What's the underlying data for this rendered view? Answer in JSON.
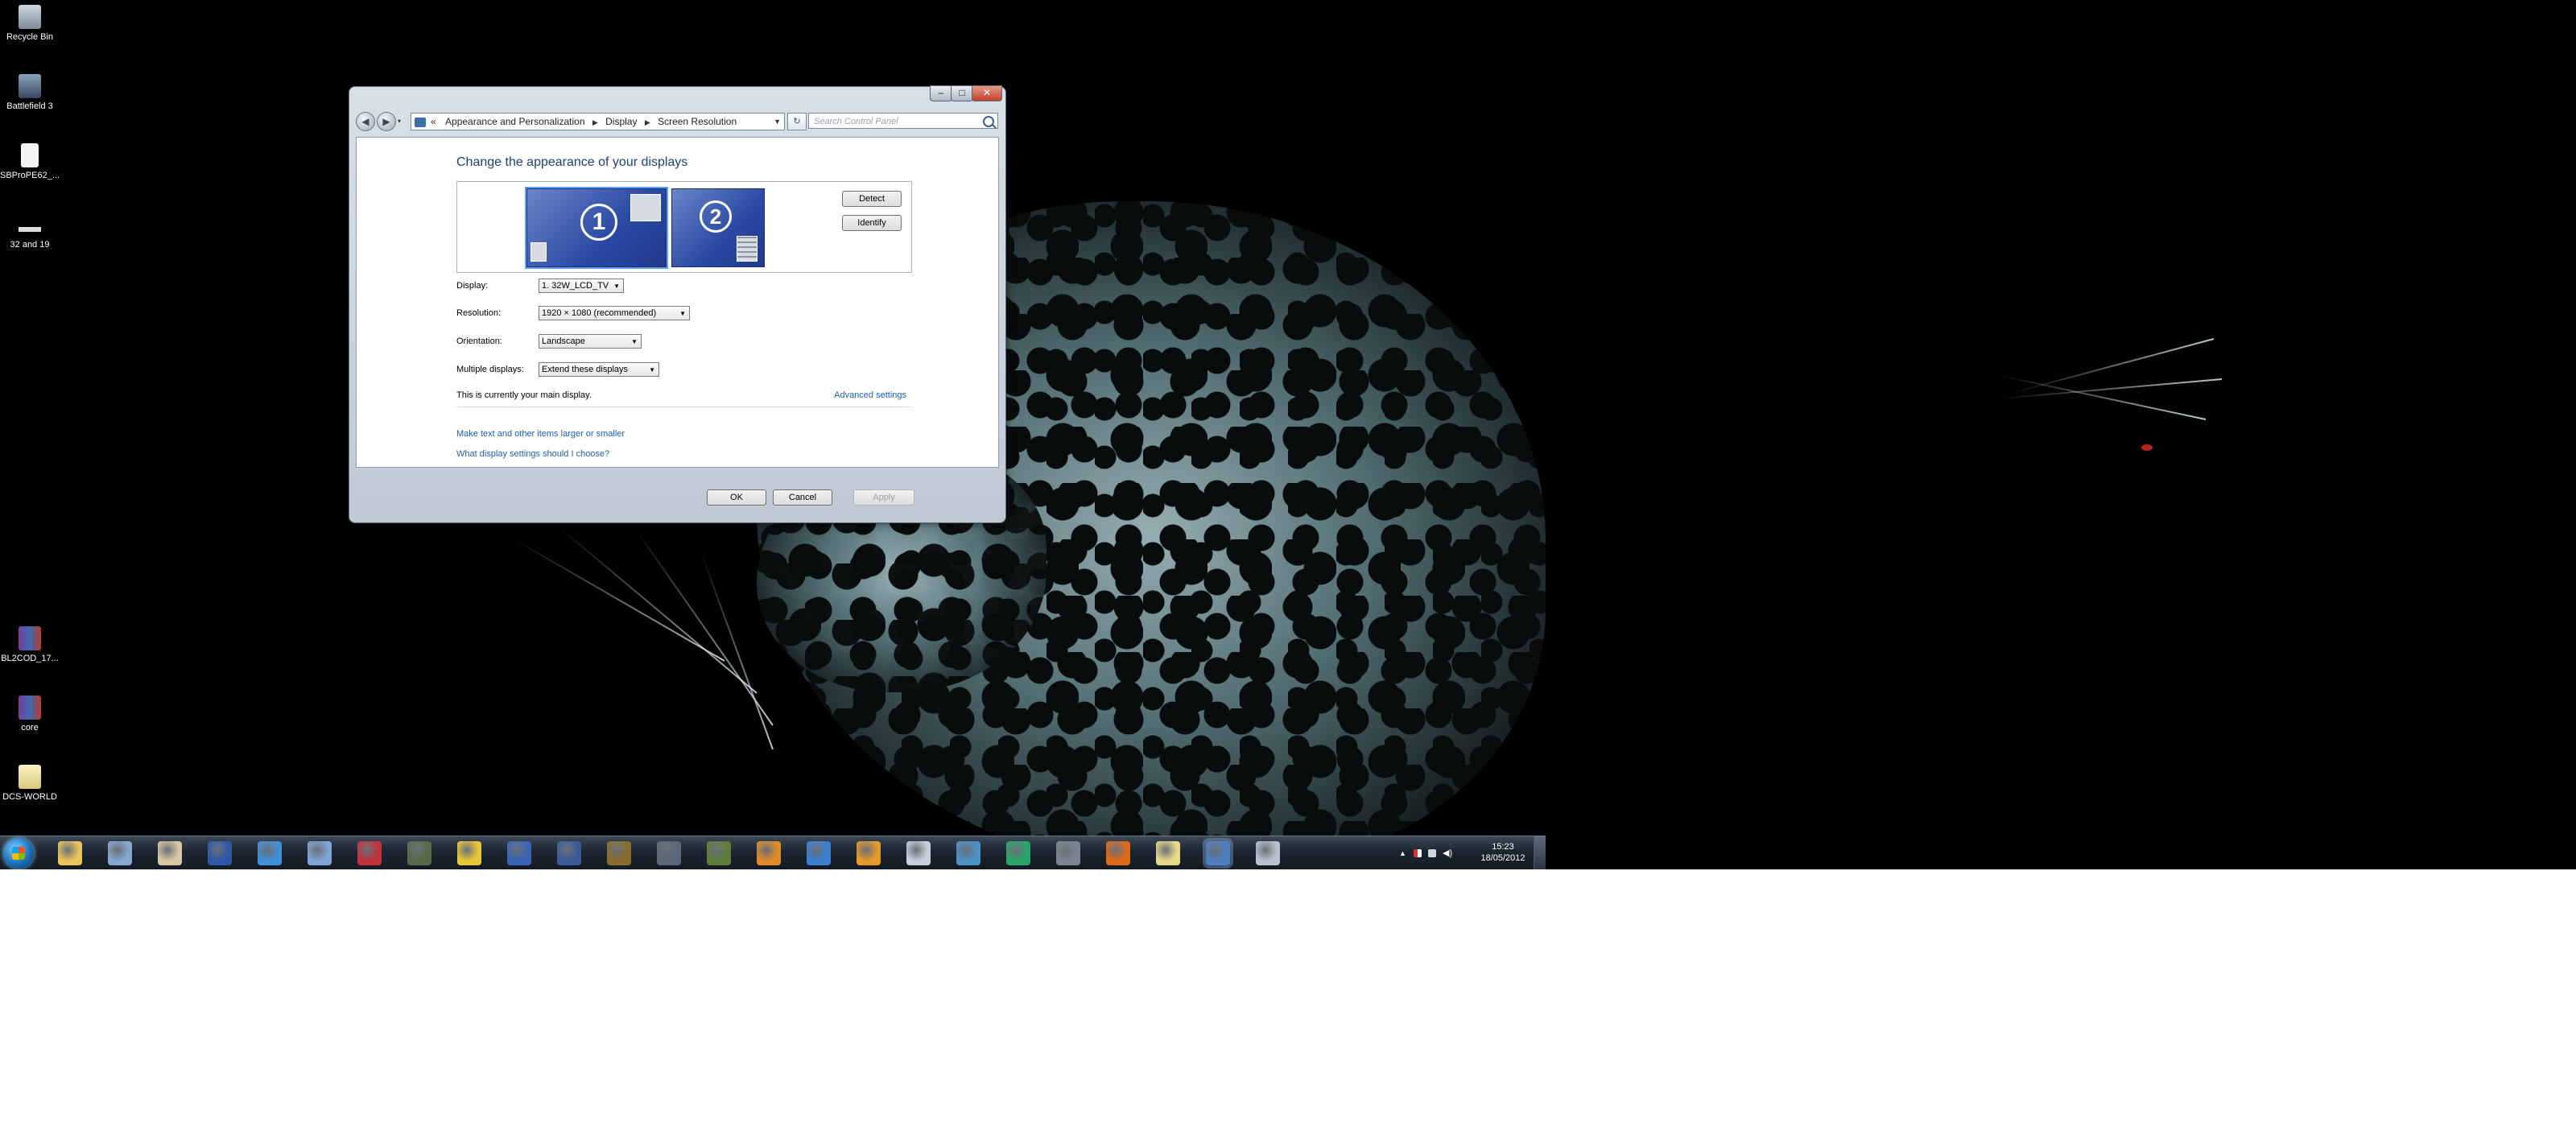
{
  "desktop": {
    "icons": [
      {
        "label": "Recycle Bin",
        "icon": "recycle-bin-icon",
        "color": "#9aa9b5"
      },
      {
        "label": "Battlefield 3",
        "icon": "battlefield-icon",
        "color": "#45607f"
      },
      {
        "label": "SBProPE62_...",
        "icon": "document-icon",
        "color": "#f2f2f2"
      },
      {
        "label": "32 and 19",
        "icon": "shortcut-icon",
        "color": "#dddddd"
      },
      {
        "label": "BL2COD_17...",
        "icon": "winrar-icon",
        "color": "#7a3d9a"
      },
      {
        "label": "core",
        "icon": "winrar-icon",
        "color": "#7a3d9a"
      },
      {
        "label": "DCS-WORLD",
        "icon": "folder-icon",
        "color": "#f3e9b5"
      }
    ]
  },
  "window": {
    "controls": {
      "minimize": "–",
      "maximize": "□",
      "close": "✕"
    },
    "nav": {
      "back": "◀",
      "forward": "▶"
    },
    "breadcrumb": [
      "Appearance and Personalization",
      "Display",
      "Screen Resolution"
    ],
    "breadcrumb_prefix": "«",
    "search_placeholder": "Search Control Panel",
    "heading": "Change the appearance of your displays",
    "monitors": [
      {
        "number": "1"
      },
      {
        "number": "2"
      }
    ],
    "buttons": {
      "detect": "Detect",
      "identify": "Identify",
      "ok": "OK",
      "cancel": "Cancel",
      "apply": "Apply"
    },
    "fields": {
      "display_label": "Display:",
      "display_value": "1. 32W_LCD_TV",
      "resolution_label": "Resolution:",
      "resolution_value": "1920 × 1080 (recommended)",
      "orientation_label": "Orientation:",
      "orientation_value": "Landscape",
      "multiple_label": "Multiple displays:",
      "multiple_value": "Extend these displays"
    },
    "main_display_text": "This is currently your main display.",
    "advanced_settings": "Advanced settings",
    "links": {
      "text_size": "Make text and other items larger or smaller",
      "help": "What display settings should I choose?"
    }
  },
  "taskbar": {
    "start_icon": "windows-orb-icon",
    "apps": [
      {
        "icon": "explorer-icon",
        "color": "#e9c45a"
      },
      {
        "icon": "ufo-icon",
        "color": "#86a7cf"
      },
      {
        "icon": "cookie-icon",
        "color": "#d8c7a3"
      },
      {
        "icon": "hud-icon",
        "color": "#2d57a8"
      },
      {
        "icon": "flightsim-icon",
        "color": "#3f8fd9"
      },
      {
        "icon": "joystick-icon",
        "color": "#7fa6d6"
      },
      {
        "icon": "star-icon",
        "color": "#c3323a"
      },
      {
        "icon": "tank-icon",
        "color": "#566a4a"
      },
      {
        "icon": "g-icon",
        "color": "#e8c83a"
      },
      {
        "icon": "star-badge-icon",
        "color": "#3a64b5"
      },
      {
        "icon": "red-star-icon",
        "color": "#3a5a95"
      },
      {
        "icon": "coin-icon",
        "color": "#8a6d2d"
      },
      {
        "icon": "jet-icon",
        "color": "#5a6776"
      },
      {
        "icon": "camo-icon",
        "color": "#5f7d3a"
      },
      {
        "icon": "guitar-icon",
        "color": "#e08a2a"
      },
      {
        "icon": "plane-icon",
        "color": "#3a7fd0"
      },
      {
        "icon": "tools-icon",
        "color": "#e69a2b"
      },
      {
        "icon": "moon-icon",
        "color": "#c8d0dc"
      },
      {
        "icon": "aircraft-icon",
        "color": "#4d92c7"
      },
      {
        "icon": "radar-icon",
        "color": "#2aa66a"
      },
      {
        "icon": "dcs-icon",
        "color": "#7a8590"
      },
      {
        "icon": "firefox-icon",
        "color": "#e06a1a"
      },
      {
        "icon": "folder-icon",
        "color": "#e7d98a"
      },
      {
        "icon": "control-panel-icon",
        "color": "#4d7fc0",
        "active": true
      },
      {
        "icon": "network-icon",
        "color": "#b8c2cc"
      }
    ],
    "tray_icons": [
      "show-hidden-icon",
      "flag-icon",
      "network-tray-icon",
      "volume-icon"
    ],
    "clock_time": "15:23",
    "clock_date": "18/05/2012"
  }
}
